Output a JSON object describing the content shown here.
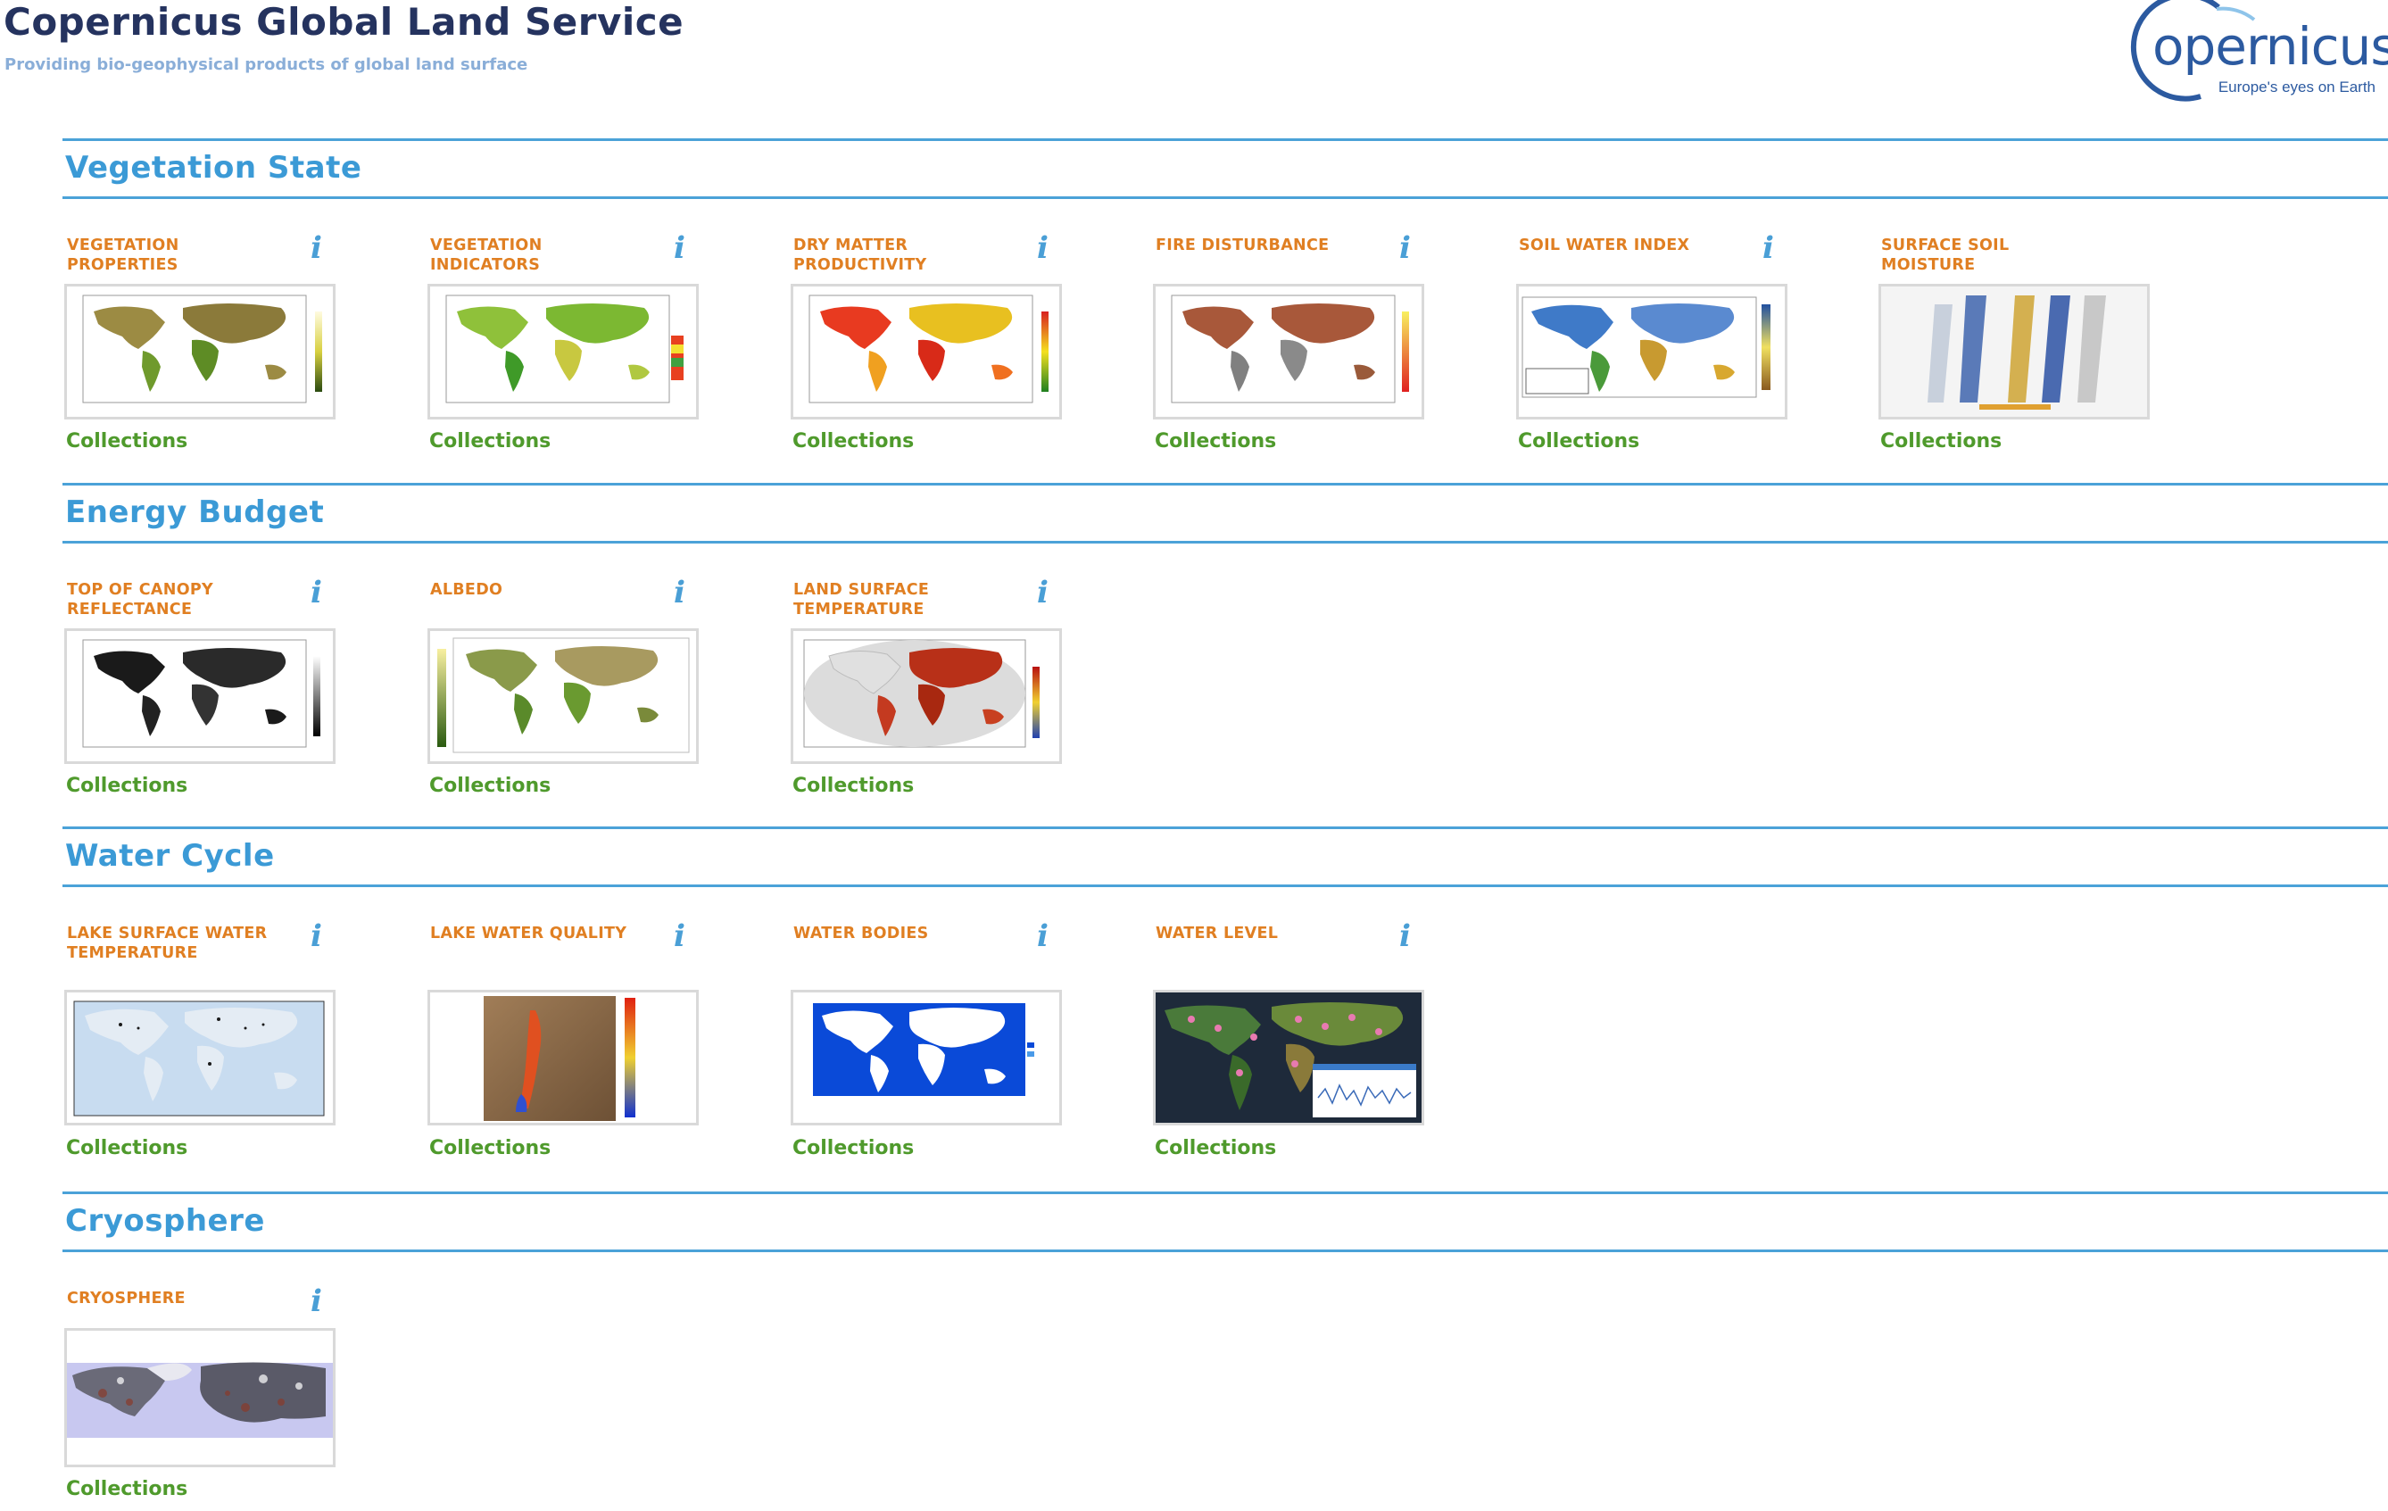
{
  "header": {
    "title": "Copernicus Global Land Service",
    "subtitle": "Providing bio-geophysical products of global land surface",
    "logo_word": "opernicus",
    "logo_tagline": "Europe's eyes on Earth"
  },
  "info_glyph": "i",
  "sections": [
    {
      "title": "Vegetation State",
      "cards": [
        {
          "title": "VEGETATION PROPERTIES",
          "link": "Collections"
        },
        {
          "title": "VEGETATION INDICATORS",
          "link": "Collections"
        },
        {
          "title": "DRY MATTER PRODUCTIVITY",
          "link": "Collections"
        },
        {
          "title": "FIRE DISTURBANCE",
          "link": "Collections"
        },
        {
          "title": "SOIL WATER INDEX",
          "link": "Collections"
        },
        {
          "title": "SURFACE SOIL MOISTURE",
          "link": "Collections"
        }
      ]
    },
    {
      "title": "Energy Budget",
      "cards": [
        {
          "title": "TOP OF CANOPY REFLECTANCE",
          "link": "Collections"
        },
        {
          "title": "ALBEDO",
          "link": "Collections"
        },
        {
          "title": "LAND SURFACE TEMPERATURE",
          "link": "Collections"
        }
      ]
    },
    {
      "title": "Water Cycle",
      "cards": [
        {
          "title": "LAKE SURFACE WATER TEMPERATURE",
          "link": "Collections"
        },
        {
          "title": "LAKE WATER QUALITY",
          "link": "Collections"
        },
        {
          "title": "WATER BODIES",
          "link": "Collections"
        },
        {
          "title": "WATER LEVEL",
          "link": "Collections"
        }
      ]
    },
    {
      "title": "Cryosphere",
      "cards": [
        {
          "title": "CRYOSPHERE",
          "link": "Collections"
        }
      ]
    }
  ],
  "colors": {
    "title": "#25335f",
    "section": "#3b9ad6",
    "card_title": "#e07f22",
    "link": "#4f9a2c"
  }
}
